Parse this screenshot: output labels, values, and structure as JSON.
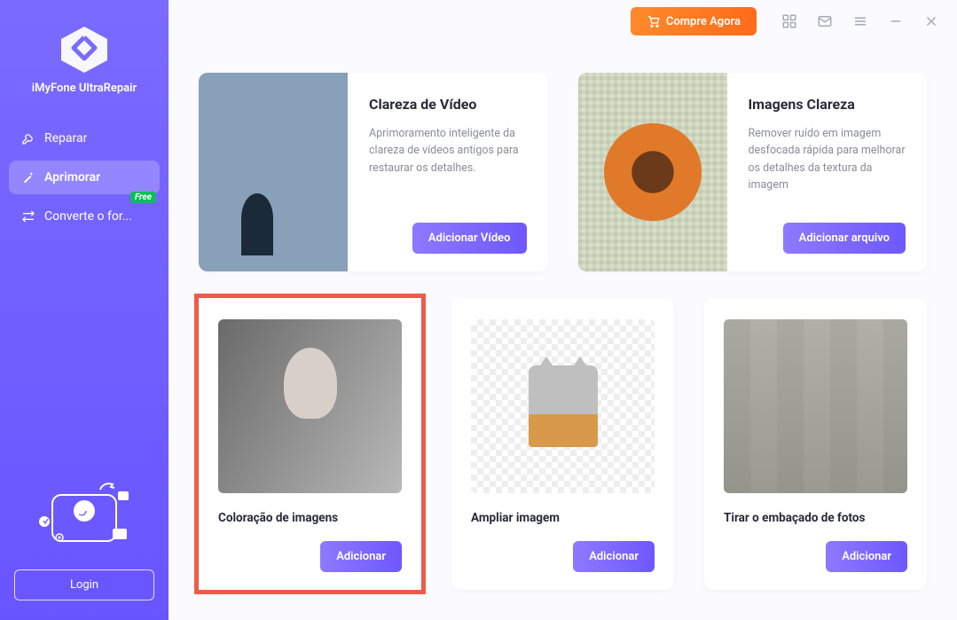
{
  "product_name": "iMyFone UltraRepair",
  "sidebar": {
    "items": [
      {
        "label": "Reparar"
      },
      {
        "label": "Aprimorar"
      },
      {
        "label": "Converte o for..."
      }
    ],
    "free_badge": "Free",
    "login": "Login"
  },
  "topbar": {
    "buy": "Compre Agora"
  },
  "cards_wide": [
    {
      "title": "Clareza de Vídeo",
      "desc": "Aprimoramento inteligente da clareza de vídeos antigos para restaurar os detalhes.",
      "cta": "Adicionar Vídeo"
    },
    {
      "title": "Imagens Clareza",
      "desc": "Remover ruído em imagem desfocada rápida  para melhorar os detalhes da textura da imagem",
      "cta": "Adicionar arquivo"
    }
  ],
  "cards_tall": [
    {
      "title": "Coloração de imagens",
      "cta": "Adicionar"
    },
    {
      "title": "Ampliar imagem",
      "cta": "Adicionar"
    },
    {
      "title": "Tirar o embaçado de fotos",
      "cta": "Adicionar"
    }
  ]
}
